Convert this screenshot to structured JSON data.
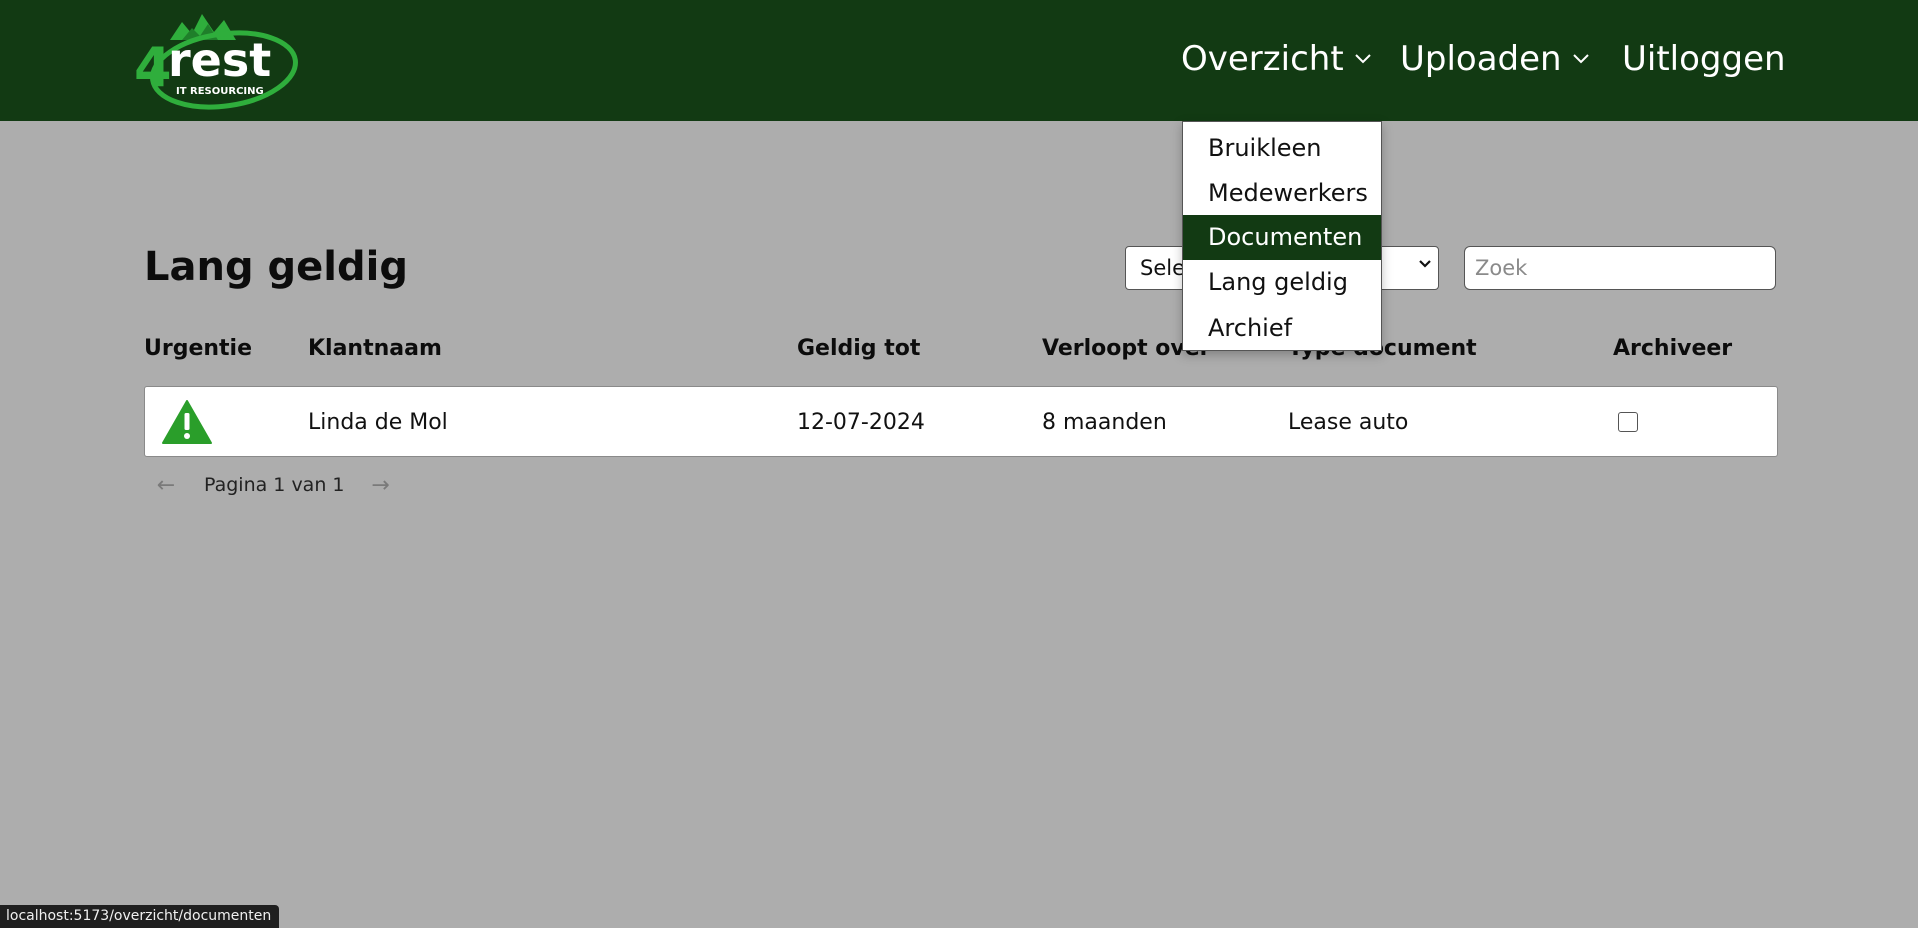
{
  "brand": {
    "logo_text": "4rest",
    "logo_subtext": "IT RESOURCING",
    "primary_color": "#123a13",
    "accent_color": "#2fae3c"
  },
  "nav": {
    "overzicht": "Overzicht",
    "uploaden": "Uploaden",
    "uitloggen": "Uitloggen"
  },
  "dropdown": {
    "items": [
      {
        "label": "Bruikleen",
        "active": false
      },
      {
        "label": "Medewerkers",
        "active": false
      },
      {
        "label": "Documenten",
        "active": true
      },
      {
        "label": "Lang geldig",
        "active": false
      },
      {
        "label": "Archief",
        "active": false
      }
    ]
  },
  "page": {
    "title": "Lang geldig"
  },
  "filters": {
    "select_value": "Sele",
    "search_placeholder": "Zoek"
  },
  "table": {
    "columns": [
      "Urgentie",
      "Klantnaam",
      "Geldig tot",
      "Verloopt over",
      "Type document",
      "Archiveer"
    ],
    "rows": [
      {
        "urgency_icon": "warning-triangle-icon",
        "urgency_color": "#2a9e2a",
        "klantnaam": "Linda de Mol",
        "geldig_tot": "12-07-2024",
        "verloopt_over": "8 maanden",
        "type_document": "Lease auto",
        "archiveer": false
      }
    ]
  },
  "pagination": {
    "text": "Pagina 1 van 1",
    "prev_icon": "arrow-left-icon",
    "next_icon": "arrow-right-icon"
  },
  "status_bar": {
    "url": "localhost:5173/overzicht/documenten"
  }
}
